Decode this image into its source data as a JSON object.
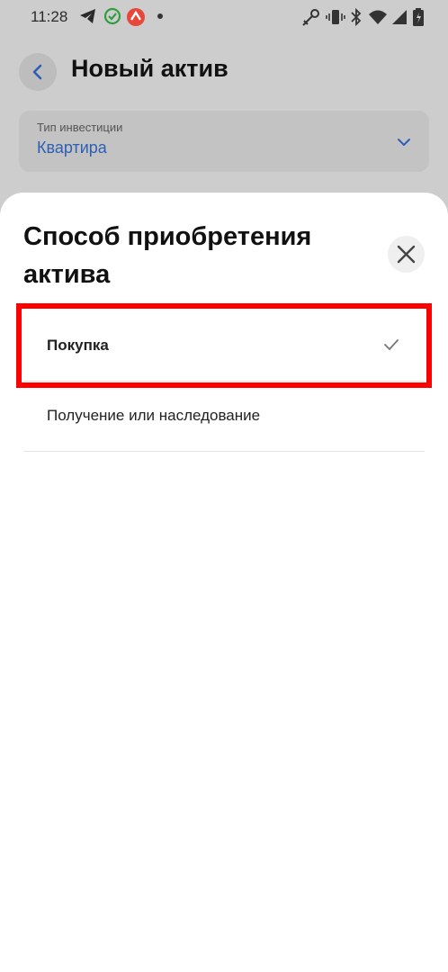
{
  "status_bar": {
    "time": "11:28",
    "left_icons": [
      "telegram-icon",
      "check-circle-icon",
      "app-notification-icon",
      "dot-icon"
    ],
    "right_icons": [
      "key-icon",
      "vibrate-icon",
      "bluetooth-icon",
      "wifi-icon",
      "signal-icon",
      "battery-icon"
    ]
  },
  "header": {
    "title": "Новый актив"
  },
  "investment_type": {
    "label": "Тип инвестиции",
    "value": "Квартира"
  },
  "sheet": {
    "title": "Способ приобретения актива",
    "options": [
      {
        "label": "Покупка",
        "selected": true
      },
      {
        "label": "Получение или наследование",
        "selected": false
      }
    ]
  },
  "colors": {
    "accent": "#2e5fb5",
    "highlight": "#ff0000",
    "overlay": "#cdcdcd",
    "telegram": "#2a2a2a",
    "check_green": "#2e9e3e",
    "app_red": "#e8473b"
  }
}
